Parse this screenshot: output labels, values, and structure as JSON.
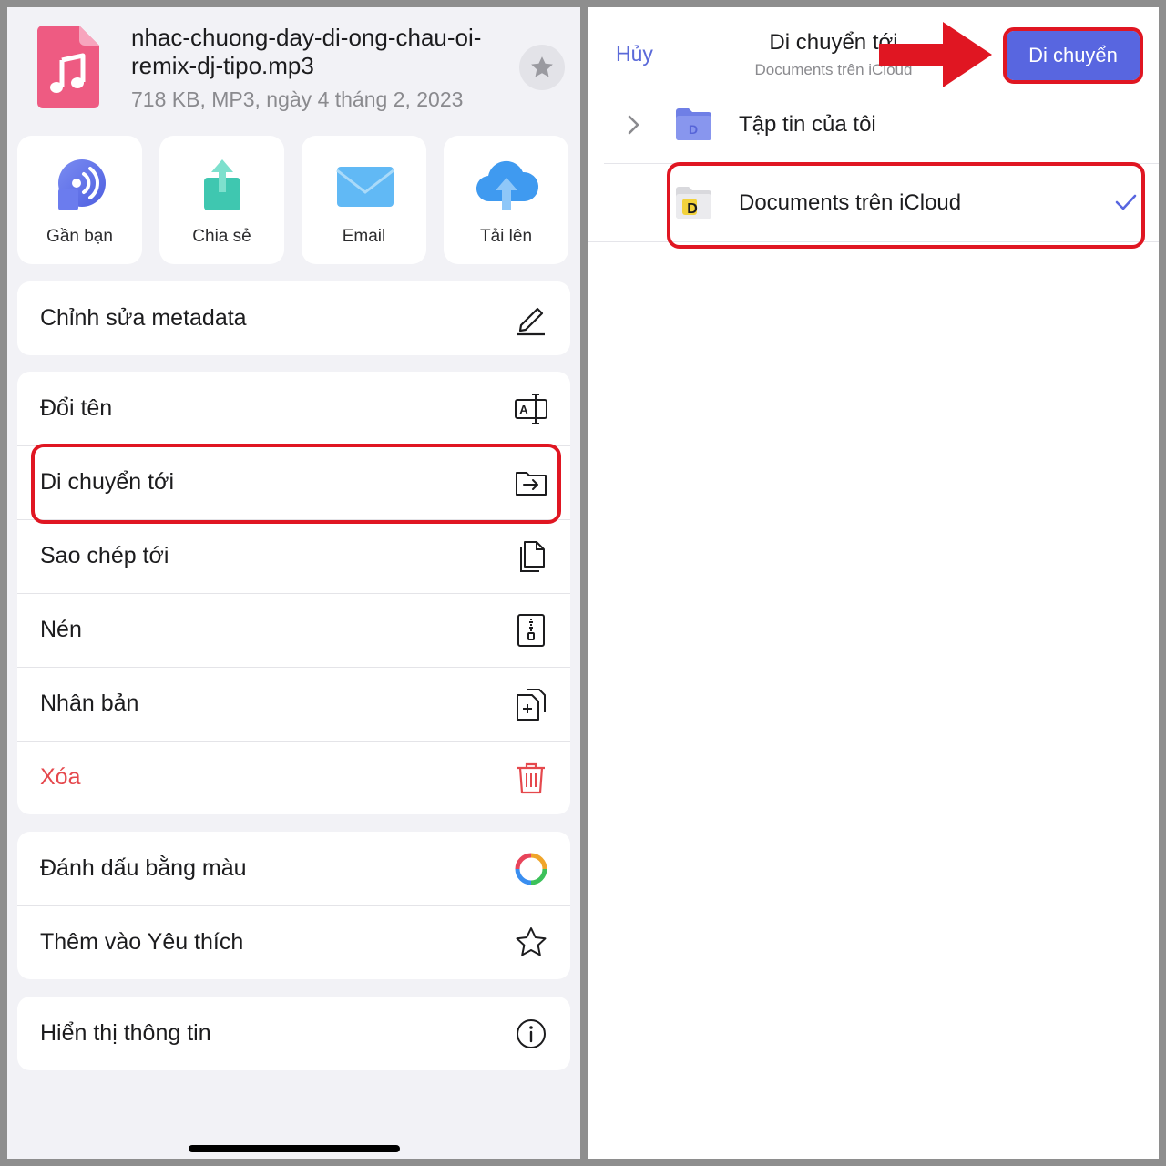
{
  "file": {
    "name": "nhac-chuong-day-di-ong-chau-oi-remix-dj-tipo.mp3",
    "meta": "718 KB, MP3, ngày 4 tháng 2, 2023"
  },
  "quick_actions": [
    {
      "label": "Gần bạn",
      "icon": "nearby-icon"
    },
    {
      "label": "Chia sẻ",
      "icon": "share-icon"
    },
    {
      "label": "Email",
      "icon": "email-icon"
    },
    {
      "label": "Tải lên",
      "icon": "cloud-upload-icon"
    }
  ],
  "menu": {
    "edit_metadata": "Chỉnh sửa metadata",
    "rename": "Đổi tên",
    "move_to": "Di chuyển tới",
    "copy_to": "Sao chép tới",
    "compress": "Nén",
    "duplicate": "Nhân bản",
    "delete": "Xóa",
    "color_tag": "Đánh dấu bằng màu",
    "add_favorite": "Thêm vào Yêu thích",
    "show_info": "Hiển thị thông tin"
  },
  "move_dialog": {
    "cancel": "Hủy",
    "title": "Di chuyển tới",
    "subtitle": "Documents trên iCloud",
    "confirm": "Di chuyển",
    "folders": [
      {
        "label": "Tập tin của tôi",
        "icon": "folder-icon",
        "selected": false
      },
      {
        "label": "Documents trên iCloud",
        "icon": "icloud-documents-folder-icon",
        "selected": true
      }
    ]
  },
  "colors": {
    "accent": "#5866e0",
    "danger": "#e5484d",
    "highlight": "#e01622"
  }
}
